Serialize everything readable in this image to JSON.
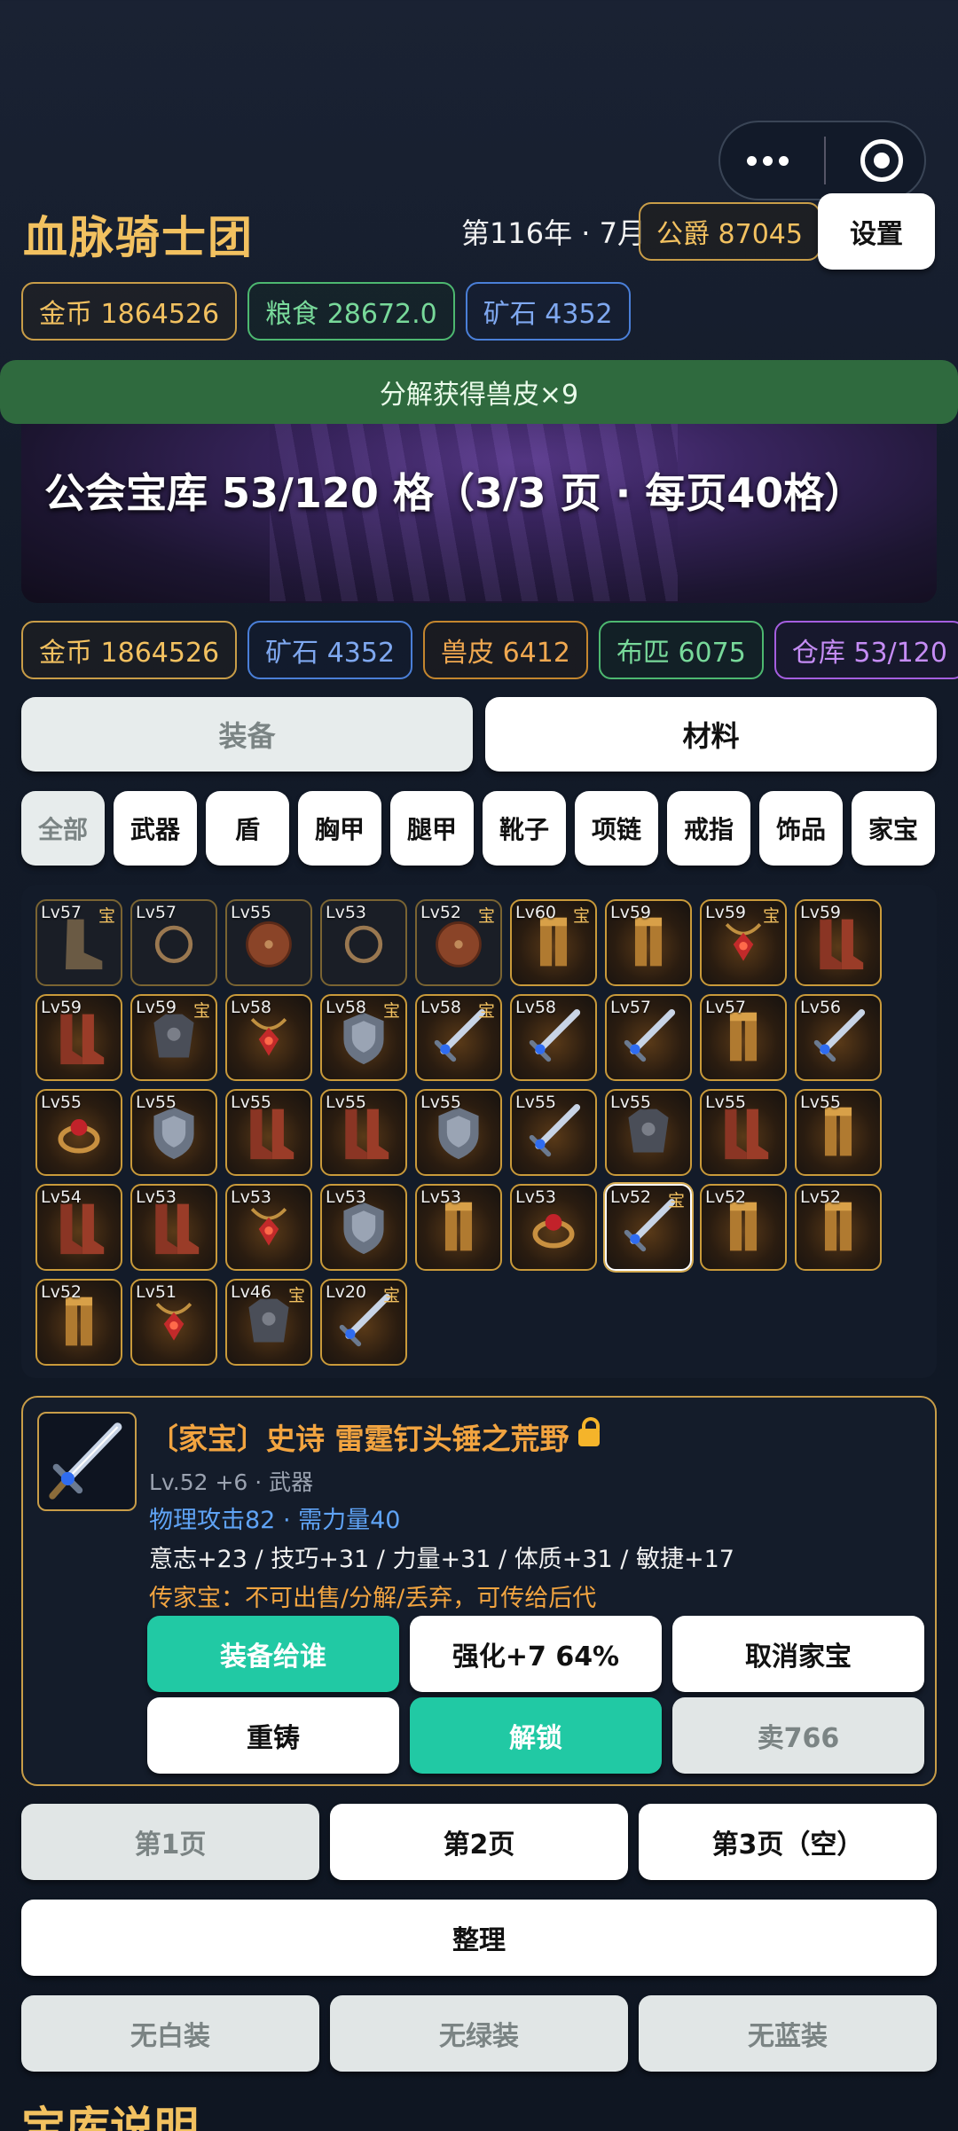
{
  "header": {
    "guild_name": "血脉骑士团",
    "date": "第116年 · 7月",
    "rank": "公爵 87045",
    "settings_label": "设置"
  },
  "resources_top": [
    {
      "label": "金币 1864526",
      "tone": "gold"
    },
    {
      "label": "粮食 28672.0",
      "tone": "green"
    },
    {
      "label": "矿石 4352",
      "tone": "blue"
    }
  ],
  "toast": "分解获得兽皮×9",
  "vault": {
    "title": "公会宝库 53/120 格（3/3 页 · 每页40格）",
    "resources": [
      {
        "label": "金币 1864526",
        "tone": "gold"
      },
      {
        "label": "矿石 4352",
        "tone": "blue"
      },
      {
        "label": "兽皮 6412",
        "tone": "orange"
      },
      {
        "label": "布匹 6075",
        "tone": "green"
      },
      {
        "label": "仓库 53/120",
        "tone": "purple"
      }
    ]
  },
  "main_tabs": [
    {
      "label": "装备",
      "selected": true
    },
    {
      "label": "材料",
      "selected": false
    }
  ],
  "categories": [
    {
      "label": "全部",
      "selected": true
    },
    {
      "label": "武器"
    },
    {
      "label": "盾"
    },
    {
      "label": "胸甲"
    },
    {
      "label": "腿甲"
    },
    {
      "label": "靴子"
    },
    {
      "label": "项链"
    },
    {
      "label": "戒指"
    },
    {
      "label": "饰品"
    },
    {
      "label": "家宝"
    }
  ],
  "inventory": [
    {
      "lv": "Lv57",
      "bao": "宝",
      "icon": "boot-icon",
      "style": "dark"
    },
    {
      "lv": "Lv57",
      "bao": "",
      "icon": "ring-icon",
      "style": "dark"
    },
    {
      "lv": "Lv55",
      "bao": "",
      "icon": "round-shield-icon",
      "style": "dark"
    },
    {
      "lv": "Lv53",
      "bao": "",
      "icon": "ring-icon",
      "style": "dark"
    },
    {
      "lv": "Lv52",
      "bao": "宝",
      "icon": "round-shield-icon",
      "style": "dark"
    },
    {
      "lv": "Lv60",
      "bao": "宝",
      "icon": "leg-armor-icon",
      "style": "glow"
    },
    {
      "lv": "Lv59",
      "bao": "",
      "icon": "leg-armor-icon",
      "style": "glow"
    },
    {
      "lv": "Lv59",
      "bao": "宝",
      "icon": "amulet-icon",
      "style": "glow"
    },
    {
      "lv": "Lv59",
      "bao": "",
      "icon": "boots-icon",
      "style": "glow"
    },
    {
      "lv": "Lv59",
      "bao": "",
      "icon": "boots-icon",
      "style": "glow"
    },
    {
      "lv": "Lv59",
      "bao": "宝",
      "icon": "chest-armor-icon",
      "style": "glow"
    },
    {
      "lv": "Lv58",
      "bao": "",
      "icon": "amulet-icon",
      "style": "glow"
    },
    {
      "lv": "Lv58",
      "bao": "宝",
      "icon": "kite-shield-icon",
      "style": "glow"
    },
    {
      "lv": "Lv58",
      "bao": "宝",
      "icon": "sword-icon",
      "style": "glow"
    },
    {
      "lv": "Lv58",
      "bao": "",
      "icon": "sword-icon",
      "style": "glow"
    },
    {
      "lv": "Lv57",
      "bao": "",
      "icon": "sword-icon",
      "style": "glow"
    },
    {
      "lv": "Lv57",
      "bao": "",
      "icon": "leg-armor-icon",
      "style": "glow"
    },
    {
      "lv": "Lv56",
      "bao": "",
      "icon": "sword-icon",
      "style": "glow"
    },
    {
      "lv": "Lv55",
      "bao": "",
      "icon": "gem-ring-icon",
      "style": "glow"
    },
    {
      "lv": "Lv55",
      "bao": "",
      "icon": "kite-shield-icon",
      "style": "glow"
    },
    {
      "lv": "Lv55",
      "bao": "",
      "icon": "boots-icon",
      "style": "glow"
    },
    {
      "lv": "Lv55",
      "bao": "",
      "icon": "boots-icon",
      "style": "glow"
    },
    {
      "lv": "Lv55",
      "bao": "",
      "icon": "kite-shield-icon",
      "style": "glow"
    },
    {
      "lv": "Lv55",
      "bao": "",
      "icon": "sword-icon",
      "style": "glow"
    },
    {
      "lv": "Lv55",
      "bao": "",
      "icon": "chest-armor-icon",
      "style": "glow"
    },
    {
      "lv": "Lv55",
      "bao": "",
      "icon": "boots-icon",
      "style": "glow"
    },
    {
      "lv": "Lv55",
      "bao": "",
      "icon": "leg-armor-icon",
      "style": "glow"
    },
    {
      "lv": "Lv54",
      "bao": "",
      "icon": "boots-icon",
      "style": "glow"
    },
    {
      "lv": "Lv53",
      "bao": "",
      "icon": "boots-icon",
      "style": "glow"
    },
    {
      "lv": "Lv53",
      "bao": "",
      "icon": "amulet-icon",
      "style": "glow"
    },
    {
      "lv": "Lv53",
      "bao": "",
      "icon": "kite-shield-icon",
      "style": "glow"
    },
    {
      "lv": "Lv53",
      "bao": "",
      "icon": "leg-armor-icon",
      "style": "glow"
    },
    {
      "lv": "Lv53",
      "bao": "",
      "icon": "gem-ring-icon",
      "style": "glow"
    },
    {
      "lv": "Lv52",
      "bao": "宝",
      "icon": "sword-icon",
      "style": "glow",
      "selected": true
    },
    {
      "lv": "Lv52",
      "bao": "",
      "icon": "leg-armor-icon",
      "style": "glow"
    },
    {
      "lv": "Lv52",
      "bao": "",
      "icon": "leg-armor-icon",
      "style": "glow"
    },
    {
      "lv": "Lv52",
      "bao": "",
      "icon": "leg-armor-icon",
      "style": "glow"
    },
    {
      "lv": "Lv51",
      "bao": "",
      "icon": "amulet-icon",
      "style": "glow"
    },
    {
      "lv": "Lv46",
      "bao": "宝",
      "icon": "chest-armor-icon",
      "style": "glow"
    },
    {
      "lv": "Lv20",
      "bao": "宝",
      "icon": "sword-icon",
      "style": "glow"
    }
  ],
  "detail": {
    "name": "〔家宝〕史诗 雷霆钉头锤之荒野",
    "sub": "Lv.52 +6 · 武器",
    "attack": "物理攻击82 · 需力量40",
    "stats": "意志+23 / 技巧+31 / 力量+31 / 体质+31 / 敏捷+17",
    "heirloom": "传家宝：不可出售/分解/丢弃，可传给后代",
    "buttons": [
      {
        "label": "装备给谁",
        "tone": "teal"
      },
      {
        "label": "强化+7 64%",
        "tone": "white"
      },
      {
        "label": "取消家宝",
        "tone": "white"
      },
      {
        "label": "重铸",
        "tone": "white"
      },
      {
        "label": "解锁",
        "tone": "teal"
      },
      {
        "label": "卖766",
        "tone": "gray"
      }
    ]
  },
  "pages": [
    {
      "label": "第1页",
      "tone": "gray"
    },
    {
      "label": "第2页",
      "tone": "white"
    },
    {
      "label": "第3页（空）",
      "tone": "white"
    }
  ],
  "sort_label": "整理",
  "filters": [
    {
      "label": "无白装"
    },
    {
      "label": "无绿装"
    },
    {
      "label": "无蓝装"
    }
  ],
  "footer_title": "宝库说明"
}
